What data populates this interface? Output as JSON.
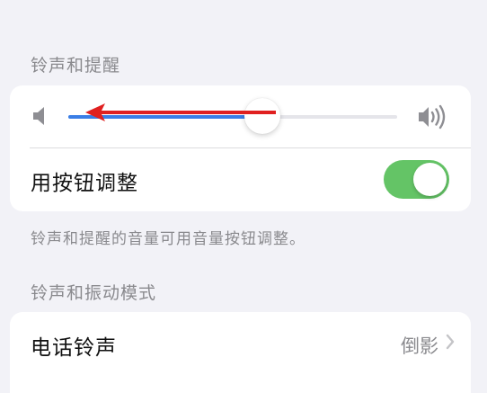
{
  "sound_settings": {
    "ringer_section_header": "铃声和提醒",
    "ringer_volume_level": 0.59,
    "change_with_buttons_label": "用按钮调整",
    "change_with_buttons_on": true,
    "ringer_footnote": "铃声和提醒的音量可用音量按钮调整。",
    "patterns_section_header": "铃声和振动模式",
    "ringtone_label": "电话铃声",
    "ringtone_value": "倒影"
  },
  "annotation": {
    "arrow_color": "#e02020",
    "direction": "left"
  },
  "colors": {
    "toggle_on": "#64c466",
    "slider_fill": "#3a7ee6"
  },
  "icons": {
    "volume_low": "speaker-low-icon",
    "volume_high": "speaker-high-icon",
    "chevron": "chevron-right-icon"
  }
}
